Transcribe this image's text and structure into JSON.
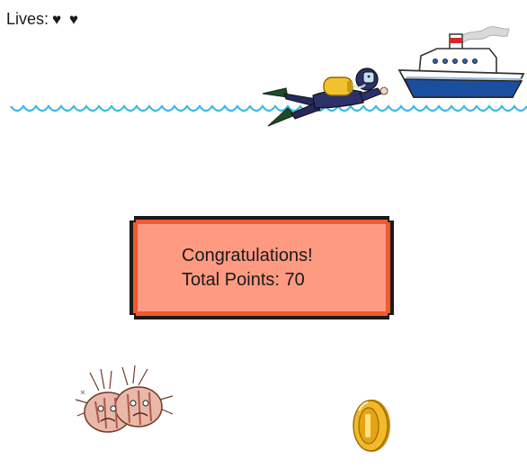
{
  "hud": {
    "lives_label": "Lives:",
    "lives_remaining": 2,
    "lives_display": "♥ ♥"
  },
  "dialog": {
    "line1": "Congratulations!",
    "line2": "Total Points: 70"
  },
  "sprites": {
    "player": "scuba-diver",
    "vessel": "boat",
    "enemy": "lionfish-pair",
    "pickup": "gold-coin"
  },
  "colors": {
    "water": "#3fb8e6",
    "dialog_fill": "#fe9a82",
    "dialog_border": "#ef5a2e",
    "dialog_outline": "#1a1a1a",
    "coin": "#e3a418"
  }
}
